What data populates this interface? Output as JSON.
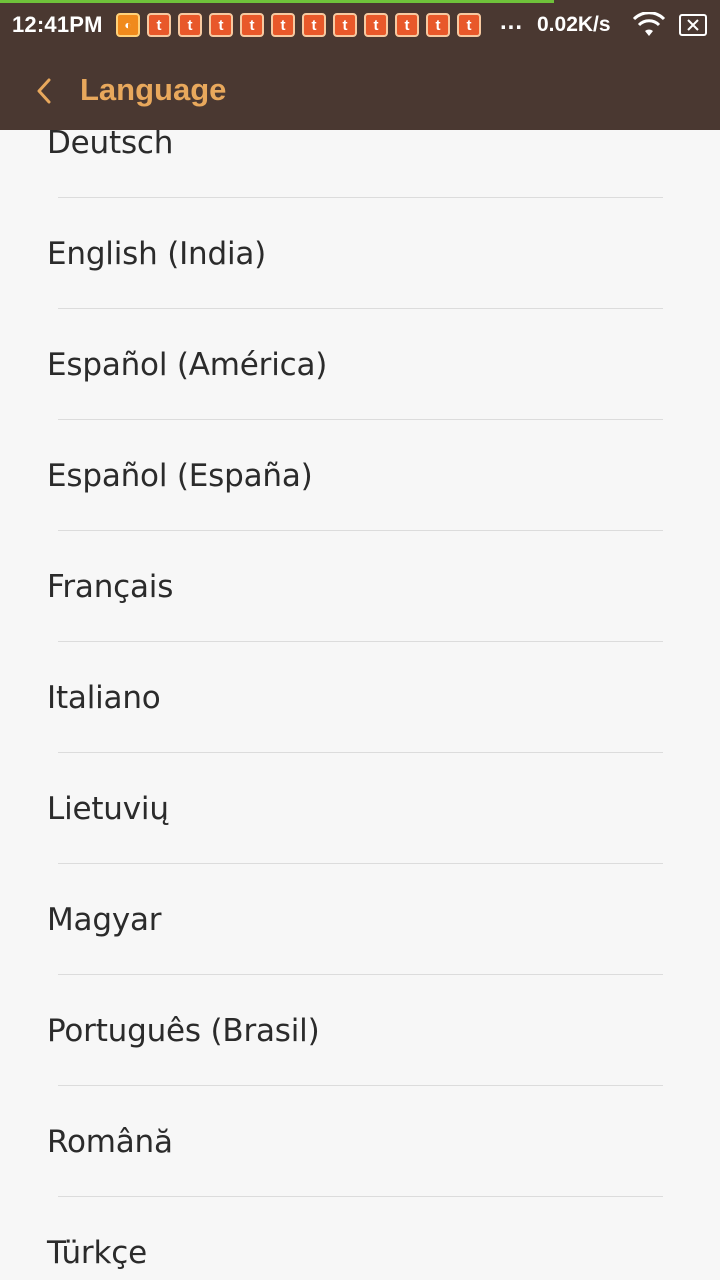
{
  "status_bar": {
    "time": "12:41PM",
    "notification_icons": [
      "uc-browser-icon",
      "t-app-icon",
      "t-app-icon",
      "t-app-icon",
      "t-app-icon",
      "t-app-icon",
      "t-app-icon",
      "t-app-icon",
      "t-app-icon",
      "t-app-icon",
      "t-app-icon",
      "t-app-icon"
    ],
    "overflow_indicator": "...",
    "network_speed": "0.02K/s",
    "wifi_icon": "wifi-icon",
    "battery_icon": "battery-charging-icon"
  },
  "action_bar": {
    "back_icon": "chevron-left-icon",
    "title": "Language",
    "background_color": "#4a3831",
    "title_color": "#e8a85c"
  },
  "languages": [
    {
      "label": "Deutsch"
    },
    {
      "label": "English (India)"
    },
    {
      "label": "Español (América)"
    },
    {
      "label": "Español (España)"
    },
    {
      "label": "Français"
    },
    {
      "label": "Italiano"
    },
    {
      "label": "Lietuvių"
    },
    {
      "label": "Magyar"
    },
    {
      "label": "Português (Brasil)"
    },
    {
      "label": "Română"
    },
    {
      "label": "Türkçe"
    }
  ]
}
